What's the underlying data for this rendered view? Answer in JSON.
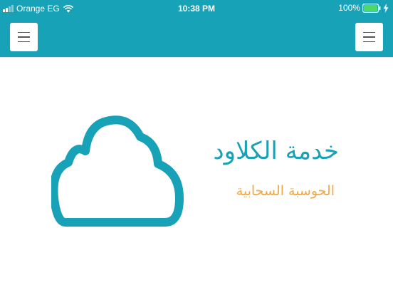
{
  "status_bar": {
    "carrier": "Orange EG",
    "time": "10:38 PM",
    "battery_percent": "100%",
    "battery_level": 1.0,
    "battery_color": "#4cd964"
  },
  "nav": {
    "left_button_icon": "hamburger-menu-icon",
    "right_button_icon": "hamburger-menu-icon"
  },
  "content": {
    "icon": "cloud-icon",
    "title": "خدمة الكلاود",
    "subtitle": "الحوسبة السحابية"
  },
  "colors": {
    "primary": "#17a2b8",
    "accent": "#f0a848",
    "background": "#ffffff"
  }
}
